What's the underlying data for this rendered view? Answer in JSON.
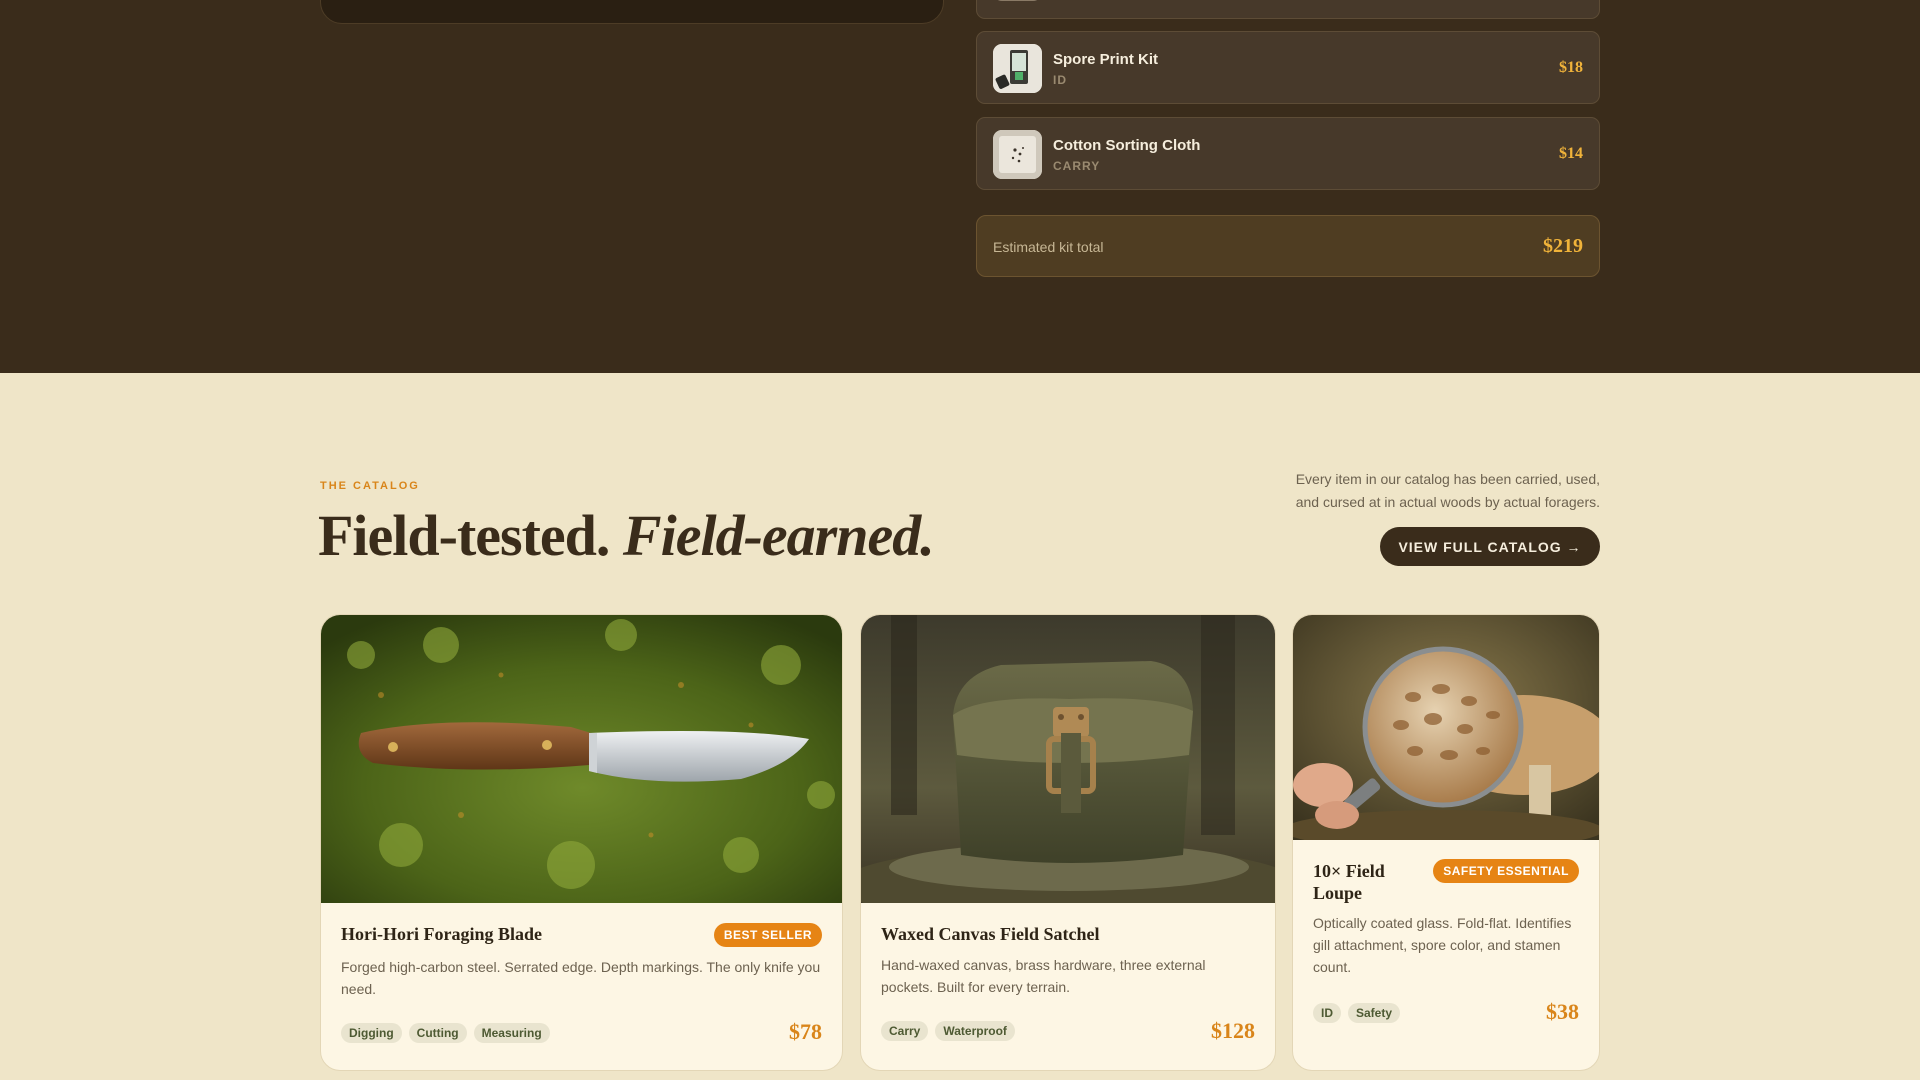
{
  "kit": {
    "items": [
      {
        "name": "",
        "category": "",
        "price": "",
        "icon": "mushroom-thumb-icon"
      },
      {
        "name": "Spore Print Kit",
        "category": "ID",
        "price": "$18",
        "icon": "spore-print-kit-icon"
      },
      {
        "name": "Cotton Sorting Cloth",
        "category": "CARRY",
        "price": "$14",
        "icon": "cotton-cloth-icon"
      }
    ],
    "total_label": "Estimated kit total",
    "total_value": "$219"
  },
  "catalog": {
    "eyebrow": "THE CATALOG",
    "headline_plain": "Field-tested.",
    "headline_italic": "Field-earned.",
    "intro": "Every item in our catalog has been carried, used, and cursed at in actual woods by actual foragers.",
    "button_label": "VIEW FULL CATALOG →"
  },
  "products": [
    {
      "title": "Hori-Hori Foraging Blade",
      "badge": "BEST SELLER",
      "description": "Forged high-carbon steel. Serrated edge. Depth markings. The only knife you need.",
      "tags": [
        "Digging",
        "Cutting",
        "Measuring"
      ],
      "price": "$78",
      "image": "knife-on-moss-photo"
    },
    {
      "title": "Waxed Canvas Field Satchel",
      "badge": "",
      "description": "Hand-waxed canvas, brass hardware, three external pockets. Built for every terrain.",
      "tags": [
        "Carry",
        "Waterproof"
      ],
      "price": "$128",
      "image": "canvas-satchel-photo"
    },
    {
      "title": "10× Field Loupe",
      "badge": "SAFETY ESSENTIAL",
      "description": "Optically coated glass. Fold-flat. Identifies gill attachment, spore color, and stamen count.",
      "tags": [
        "ID",
        "Safety"
      ],
      "price": "$38",
      "image": "loupe-mushroom-photo"
    }
  ],
  "colors": {
    "dark_bg": "#3a2c1b",
    "cream_bg": "#efe5c8",
    "accent_orange": "#e68414",
    "price_gold": "#f0b33a"
  }
}
